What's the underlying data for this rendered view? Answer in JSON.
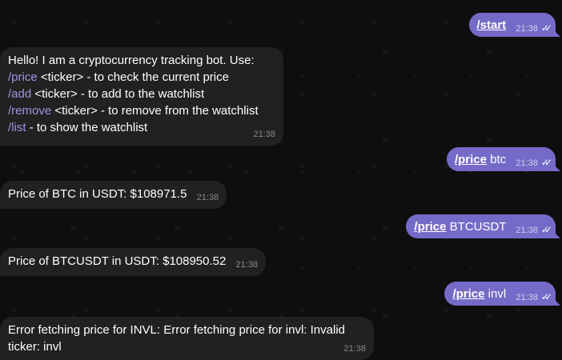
{
  "messages": [
    {
      "cmd": "/start",
      "rest": "",
      "time": "21:38"
    },
    {
      "greeting": "Hello! I am a cryptocurrency tracking bot. Use:",
      "lines": [
        {
          "cmd": "/price",
          "text": " <ticker> - to check the current price"
        },
        {
          "cmd": "/add",
          "text": " <ticker> - to add to the watchlist"
        },
        {
          "cmd": "/remove",
          "text": " <ticker> - to remove from the watchlist"
        },
        {
          "cmd": "/list",
          "text": " - to show the watchlist"
        }
      ],
      "time": "21:38"
    },
    {
      "cmd": "/price",
      "rest": " btc",
      "time": "21:38"
    },
    {
      "text": "Price of BTC in USDT: $108971.5",
      "time": "21:38"
    },
    {
      "cmd": "/price",
      "rest": " BTCUSDT",
      "time": "21:38"
    },
    {
      "text": "Price of BTCUSDT in USDT: $108950.52",
      "time": "21:38"
    },
    {
      "cmd": "/price",
      "rest": " invl",
      "time": "21:38"
    },
    {
      "text": "Error fetching price for INVL: Error fetching price for invl: Invalid ticker: invl",
      "time": "21:38"
    }
  ],
  "icons": {
    "read_receipt": "double-check-icon"
  },
  "colors": {
    "outgoing": "#766ac8",
    "incoming": "#212121",
    "command_link": "#9d95e0",
    "background": "#0e0e0f"
  }
}
